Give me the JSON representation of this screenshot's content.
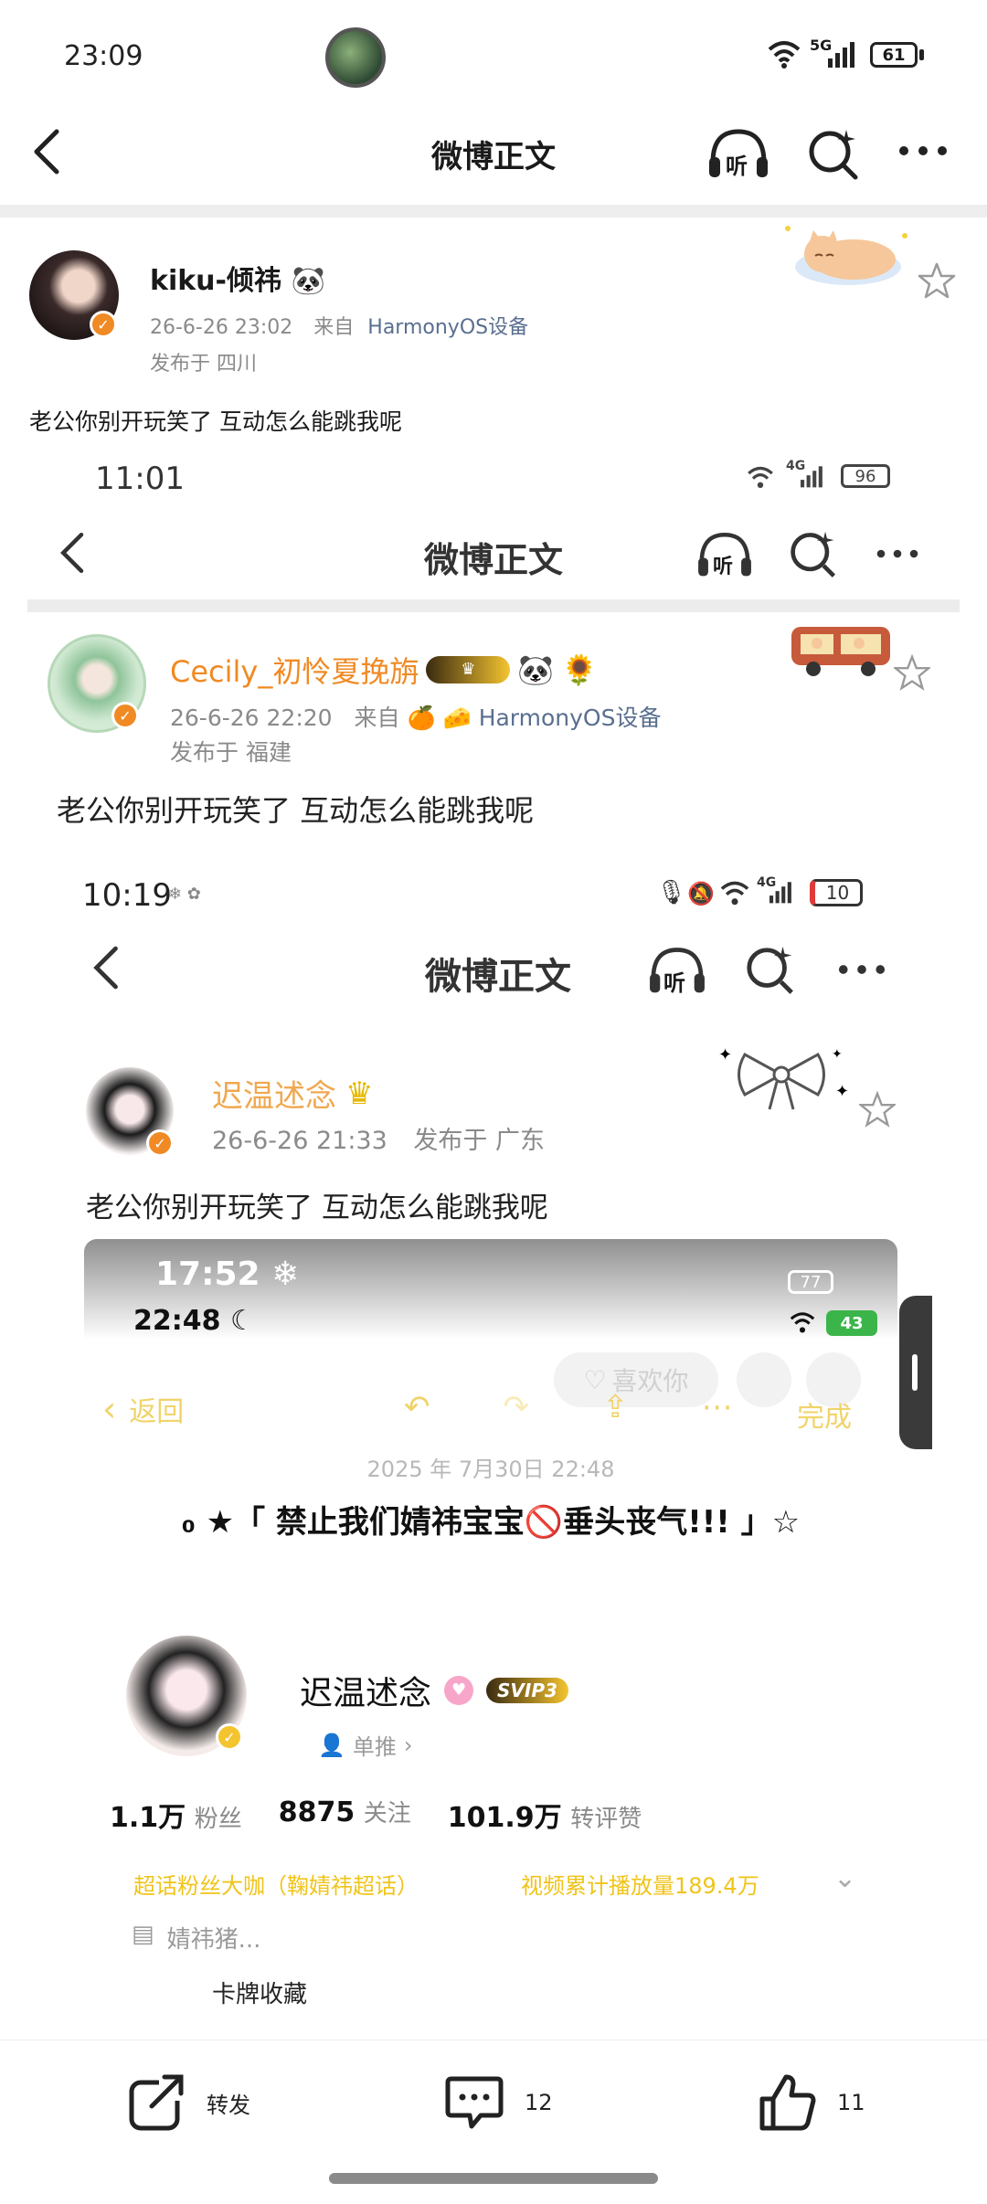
{
  "status_bar": {
    "time": "23:09",
    "battery": "61",
    "network": "5G"
  },
  "nav": {
    "title": "微博正文",
    "listen_label": "听"
  },
  "post": {
    "username": "kiku-倾祎",
    "timestamp": "26-6-26 23:02",
    "source_prefix": "来自",
    "source": "HarmonyOS设备",
    "location": "发布于 四川",
    "text": "老公你别开玩笑了 互动怎么能跳我呢"
  },
  "nested1": {
    "status_time": "11:01",
    "battery": "96",
    "network": "4G",
    "nav_title": "微博正文",
    "listen_label": "听",
    "username": "Cecily_初怜夏挽旃",
    "timestamp": "26-6-26 22:20",
    "source_prefix": "来自",
    "source": "HarmonyOS设备",
    "location": "发布于 福建",
    "text": "老公你别开玩笑了 互动怎么能跳我呢"
  },
  "nested2": {
    "status_time": "10:19",
    "battery": "10",
    "network": "4G",
    "nav_title": "微博正文",
    "listen_label": "听",
    "username": "迟温述念",
    "timestamp": "26-6-26 21:33",
    "location": "发布于 广东",
    "text": "老公你别开玩笑了 互动怎么能跳我呢"
  },
  "nested3": {
    "status_time_top": "17:52",
    "battery_top": "77",
    "status_time": "22:48",
    "battery": "43",
    "like_button_label": "喜欢你",
    "back_label": "返回",
    "done_label": "完成",
    "date_text": "2025 年 7月30日 22:48",
    "title": "₀ ★「 禁止我们婧祎宝宝🚫垂头丧气!!! 」☆",
    "username": "迟温述念",
    "vip_label": "SVIP3",
    "single_push_label": "单推",
    "stats": [
      {
        "value": "1.1万",
        "label": "粉丝"
      },
      {
        "value": "8875",
        "label": "关注"
      },
      {
        "value": "101.9万",
        "label": "转评赞"
      }
    ],
    "supertopic_label": "超话粉丝大咖（鞠婧祎超话）",
    "video_views_label": "视频累计播放量189.4万",
    "bio": "婧祎猪...",
    "card_collection": "卡牌收藏"
  },
  "bottom_bar": {
    "repost_label": "转发",
    "comment_count": "12",
    "like_count": "11"
  },
  "colors": {
    "accent_orange": "#f08a24",
    "link_blue": "#5a6f8f",
    "gold": "#e6b800",
    "yellow_text": "#f0c419"
  }
}
